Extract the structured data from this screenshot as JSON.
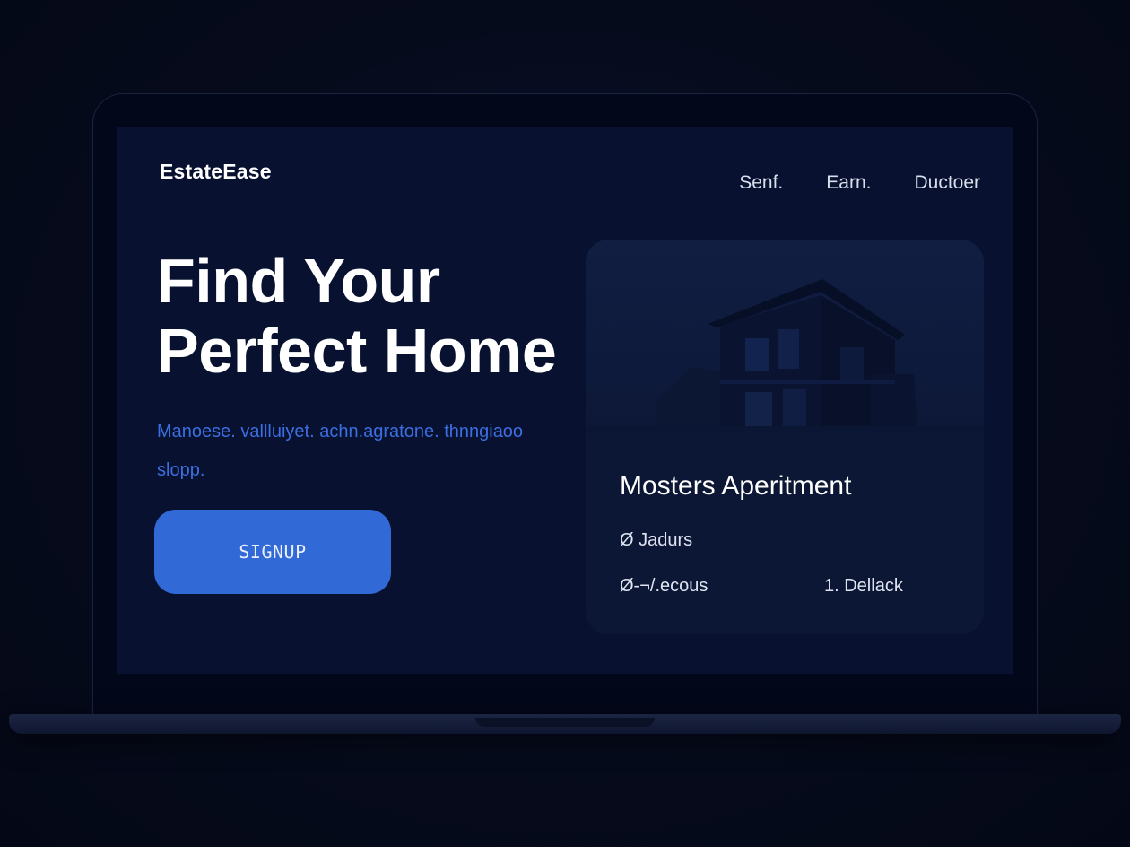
{
  "header": {
    "brand": "EstateEase",
    "nav": [
      "Senf.",
      "Earn.",
      "Ductoer"
    ]
  },
  "hero": {
    "title_line1": "Find Your",
    "title_line2": "Perfect Home",
    "subtitle": "Manoese. vallluiyet. achn.agratone. thnngiaoo slopp.",
    "cta_label": "SIGNUP"
  },
  "listing": {
    "image": "house-photo",
    "title": "Mosters Aperitment",
    "meta1": "Ø Jadurs",
    "meta2": "Ø-¬/.ecous",
    "meta3": "1. Dellack"
  },
  "colors": {
    "page_background": "#050a1a",
    "screen_background": "#081230",
    "accent": "#3169d6",
    "subtitle": "#3b6ee0",
    "card_background": "#0c1736"
  }
}
